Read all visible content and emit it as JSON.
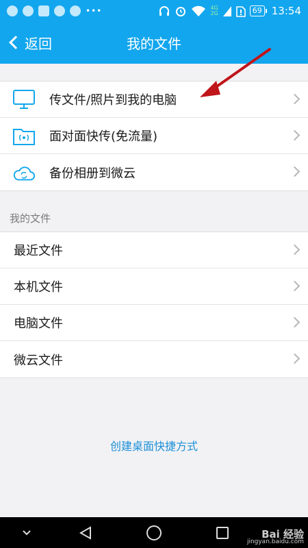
{
  "status_bar": {
    "battery": "69",
    "time": "13:54",
    "network": [
      "4G",
      "2G"
    ]
  },
  "nav": {
    "back_label": "返回",
    "title": "我的文件"
  },
  "top_list": [
    {
      "label": "传文件/照片到我的电脑",
      "icon": "monitor-icon"
    },
    {
      "label": "面对面快传(免流量)",
      "icon": "folder-wireless-icon"
    },
    {
      "label": "备份相册到微云",
      "icon": "cloud-sync-icon"
    }
  ],
  "section_header": "我的文件",
  "file_list": [
    {
      "label": "最近文件"
    },
    {
      "label": "本机文件"
    },
    {
      "label": "电脑文件"
    },
    {
      "label": "微云文件"
    }
  ],
  "shortcut_link": "创建桌面快捷方式",
  "watermark": {
    "brand": "Bai  经验",
    "url": "jingyan.baidu.com"
  },
  "colors": {
    "accent": "#12a6ee",
    "link": "#1a8fd8",
    "annotation_arrow": "#c0151a"
  }
}
